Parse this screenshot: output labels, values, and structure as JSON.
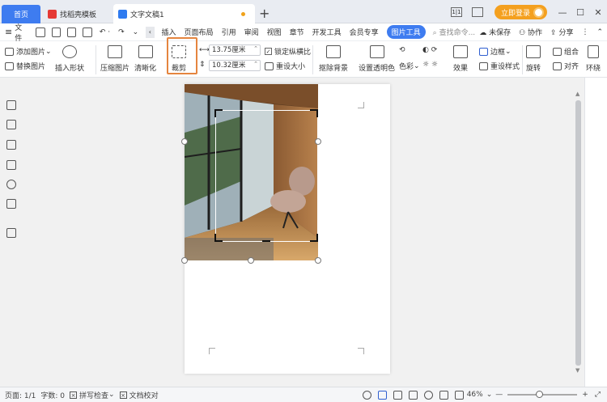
{
  "tabs": {
    "home": "首页",
    "template": "找稻壳模板",
    "doc": "文字文稿1"
  },
  "window": {
    "login": "立即登录"
  },
  "menu": {
    "file": "文件",
    "items": [
      "插入",
      "页面布局",
      "引用",
      "审阅",
      "视图",
      "章节",
      "开发工具",
      "会员专享",
      "图片工具"
    ],
    "search": "查找命令...",
    "unsaved": "未保存",
    "collab": "协作",
    "share": "分享"
  },
  "ribbon": {
    "add_image": "添加图片",
    "replace_image": "替换图片",
    "insert_shape": "插入形状",
    "compress": "压缩图片",
    "clarity": "清晰化",
    "crop": "裁剪",
    "width": "13.75厘米",
    "height": "10.32厘米",
    "lock_ratio": "锁定纵横比",
    "reset_size": "重设大小",
    "remove_bg": "抠除背景",
    "set_transparent": "设置透明色",
    "color": "色彩",
    "effects": "效果",
    "border": "边框",
    "reset_style": "重设样式",
    "rotate": "旋转",
    "group": "组合",
    "align": "对齐",
    "wrap": "环绕"
  },
  "status": {
    "page": "页面: 1/1",
    "words": "字数: 0",
    "spell": "拼写检查",
    "proof": "文档校对",
    "zoom": "46%",
    "zoom_level": 0.4
  }
}
